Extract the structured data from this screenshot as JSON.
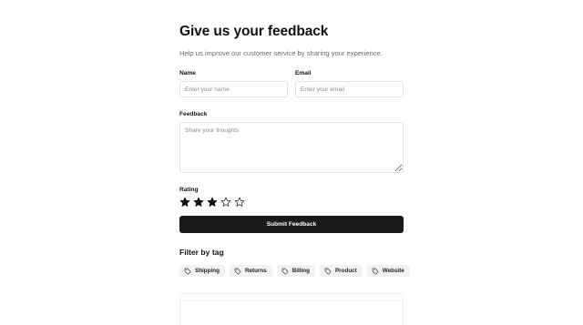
{
  "header": {
    "title": "Give us your feedback",
    "subtitle": "Help us improve our customer service by sharing your experience."
  },
  "form": {
    "name_label": "Name",
    "name_placeholder": "Enter your name",
    "name_value": "",
    "email_label": "Email",
    "email_placeholder": "Enter your email",
    "email_value": "",
    "feedback_label": "Feedback",
    "feedback_placeholder": "Share your thoughts",
    "feedback_value": "",
    "rating_label": "Rating",
    "rating": {
      "value": 3,
      "max": 5,
      "filled_icon": "star-filled-icon",
      "empty_icon": "star-outline-icon"
    },
    "submit_label": "Submit Feedback"
  },
  "filter": {
    "title": "Filter by tag",
    "tag_icon": "tag-icon",
    "tags": [
      {
        "label": "Shipping"
      },
      {
        "label": "Returns"
      },
      {
        "label": "Billing"
      },
      {
        "label": "Product"
      },
      {
        "label": "Website"
      }
    ]
  },
  "colors": {
    "primary_button": "#1a1a1a",
    "tag_background": "#f2f2f2",
    "input_border": "#e3e3e3",
    "subtitle_text": "#6b6b6b"
  }
}
